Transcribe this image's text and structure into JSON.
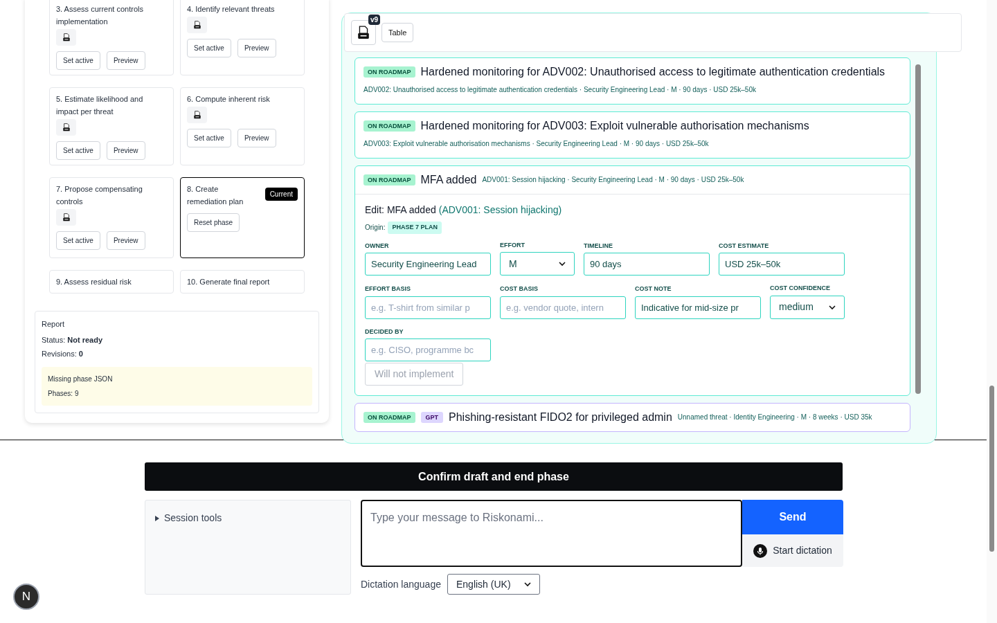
{
  "phases": [
    {
      "label": "3. Assess current controls implementation",
      "has_json": true,
      "selected": false,
      "buttons": [
        "Set active",
        "Preview"
      ]
    },
    {
      "label": "4. Identify relevant threats",
      "has_json": true,
      "selected": false,
      "buttons": [
        "Set active",
        "Preview"
      ]
    },
    {
      "label": "5. Estimate likelihood and impact per threat",
      "has_json": true,
      "selected": false,
      "buttons": [
        "Set active",
        "Preview"
      ]
    },
    {
      "label": "6. Compute inherent risk",
      "has_json": true,
      "selected": false,
      "buttons": [
        "Set active",
        "Preview"
      ]
    },
    {
      "label": "7. Propose compensating controls",
      "has_json": true,
      "selected": false,
      "buttons": [
        "Set active",
        "Preview"
      ]
    },
    {
      "label": "8. Create remediation plan",
      "has_json": false,
      "selected": true,
      "badge": "Current",
      "buttons": [
        "Reset phase"
      ]
    },
    {
      "label": "9. Assess residual risk",
      "has_json": false,
      "selected": false
    },
    {
      "label": "10. Generate final report",
      "has_json": false,
      "selected": false
    }
  ],
  "report": {
    "title": "Report",
    "status": "Status: **Not ready**",
    "revisions": "Revisions: **0**",
    "warning": {
      "title": "Missing phase JSON",
      "detail": "Phases: 9"
    }
  },
  "roadmap": {
    "toolbar": {
      "version": "v9",
      "button": "Table"
    },
    "items": [
      {
        "status": "ON ROADMAP",
        "title": "Hardened monitoring for ADV002: Unauthorised access to legitimate authentication credentials",
        "meta": "ADV002: Unauthorised access to legitimate authentication credentials · Security Engineering Lead · M · 90 days · USD 25k–50k",
        "expanded": false
      },
      {
        "status": "ON ROADMAP",
        "title": "Hardened monitoring for ADV003: Exploit vulnerable authorisation mechanisms",
        "meta": "ADV003: Exploit vulnerable authorisation mechanisms · Security Engineering Lead · M · 90 days · USD 25k–50k",
        "expanded": false
      },
      {
        "status": "ON ROADMAP",
        "title": "MFA added",
        "meta": "ADV001: Session hijacking · Security Engineering Lead · M · 90 days · USD 25k–50k",
        "expanded": true,
        "edit": {
          "heading": "Edit: MFA added",
          "threat": "(ADV001: Session hijacking)",
          "origin_label": "Origin:",
          "origin": "PHASE 7 PLAN",
          "fields": [
            {
              "label": "OWNER",
              "kind": "input",
              "value": "Security Engineering Lead"
            },
            {
              "label": "EFFORT",
              "kind": "select",
              "value": "M"
            },
            {
              "label": "TIMELINE",
              "kind": "input",
              "value": "90 days"
            },
            {
              "label": "COST ESTIMATE",
              "kind": "input",
              "value": "USD 25k–50k"
            },
            {
              "label": "EFFORT BASIS",
              "kind": "input",
              "placeholder": "e.g. T-shirt from similar p"
            },
            {
              "label": "COST BASIS",
              "kind": "input",
              "placeholder": "e.g. vendor quote, intern"
            },
            {
              "label": "COST NOTE",
              "kind": "input",
              "value": "Indicative for mid-size pr"
            },
            {
              "label": "COST CONFIDENCE",
              "kind": "select",
              "value": "medium"
            },
            {
              "label": "DECIDED BY",
              "kind": "input",
              "placeholder": "e.g. CISO, programme bc"
            }
          ],
          "button": {
            "label": "Will not implement",
            "disabled": true
          }
        }
      },
      {
        "status": "ON ROADMAP",
        "tag": "GPT",
        "title": "Phishing-resistant FIDO2 for privileged admin",
        "meta": "Unnamed threat · Identity Engineering · M · 8 weeks · USD 35k",
        "expanded": false
      }
    ]
  },
  "confirm_button": "Confirm draft and end phase",
  "session_tools": {
    "label": "Session tools",
    "expanded": false
  },
  "message": {
    "placeholder": "Type your message to Riskonami..."
  },
  "send_button": "Send",
  "dictation_button": "Start dictation",
  "dictation_language": {
    "label": "Dictation language",
    "value": "English (UK)"
  },
  "avatar": "N"
}
